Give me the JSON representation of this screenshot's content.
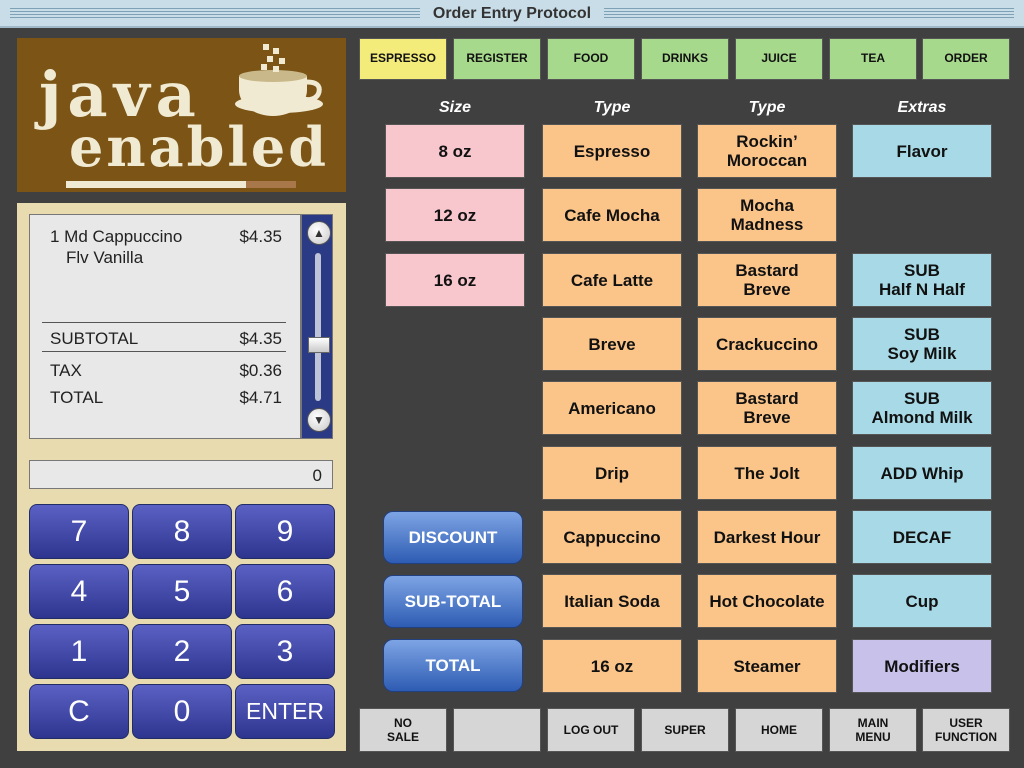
{
  "window": {
    "title": "Order Entry Protocol"
  },
  "logo": {
    "line1": "java",
    "line2": "enabled"
  },
  "receipt": {
    "item_line": "1 Md Cappuccino",
    "item_price": "$4.35",
    "modifier": "Flv Vanilla",
    "subtotal_label": "SUBTOTAL",
    "subtotal_value": "$4.35",
    "tax_label": "TAX",
    "tax_value": "$0.36",
    "total_label": "TOTAL",
    "total_value": "$4.71"
  },
  "qty_display": "0",
  "keypad": {
    "keys": [
      "7",
      "8",
      "9",
      "4",
      "5",
      "6",
      "1",
      "2",
      "3",
      "C",
      "0",
      "ENTER"
    ]
  },
  "tabs": [
    "ESPRESSO",
    "REGISTER",
    "FOOD",
    "DRINKS",
    "JUICE",
    "TEA",
    "ORDER"
  ],
  "active_tab": "ESPRESSO",
  "columns": {
    "size": "Size",
    "type1": "Type",
    "type2": "Type",
    "extras": "Extras"
  },
  "size_buttons": [
    "8 oz",
    "12 oz",
    "16 oz"
  ],
  "type1_buttons": [
    "Espresso",
    "Cafe Mocha",
    "Cafe Latte",
    "Breve",
    "Americano",
    "Drip",
    "Cappuccino",
    "Italian Soda",
    "16 oz"
  ],
  "type2_buttons": [
    "Rockin’\nMoroccan",
    "Mocha\nMadness",
    "Bastard\nBreve",
    "Crackuccino",
    "Bastard\nBreve",
    "The Jolt",
    "Darkest Hour",
    "Hot Chocolate",
    "Steamer"
  ],
  "extras_buttons": [
    "Flavor",
    "SUB\nHalf N Half",
    "SUB\nSoy Milk",
    "SUB\nAlmond Milk",
    "ADD Whip",
    "DECAF",
    "Cup",
    "Modifiers"
  ],
  "action_buttons": {
    "discount": "DISCOUNT",
    "subtotal": "SUB-TOTAL",
    "total": "TOTAL"
  },
  "footer_buttons": [
    "NO\nSALE",
    "",
    "LOG OUT",
    "SUPER",
    "HOME",
    "MAIN\nMENU",
    "USER\nFUNCTION"
  ],
  "colors": {
    "background": "#404040",
    "tab_active": "#f3ec7a",
    "tab": "#a7d98c",
    "size_button": "#f8c7ce",
    "type_button": "#fbc58a",
    "extras_button": "#a7d9e6",
    "modifiers_button": "#c8c1ea",
    "keypad": "#3a41a8",
    "action_button": "#3f6fc6",
    "logo_bg": "#7b5416"
  },
  "icons": {
    "scroll_up": "chevron-up-icon",
    "scroll_down": "chevron-down-icon",
    "logo_cup": "coffee-cup-icon"
  }
}
